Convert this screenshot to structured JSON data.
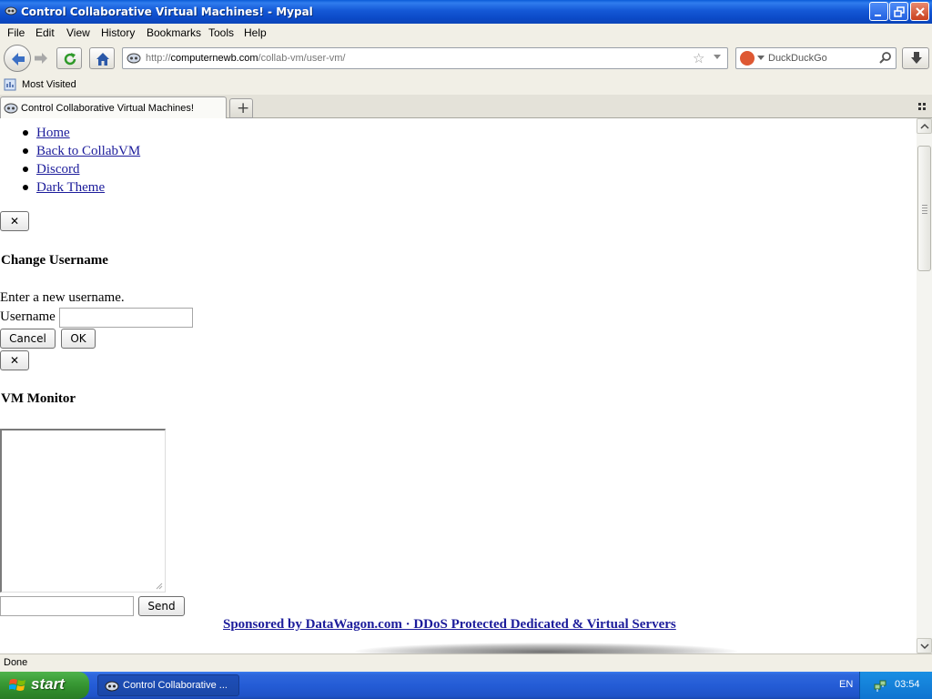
{
  "window": {
    "title": "Control Collaborative Virtual Machines! - Mypal"
  },
  "menu": {
    "items": [
      "File",
      "Edit",
      "View",
      "History",
      "Bookmarks",
      "Tools",
      "Help"
    ]
  },
  "navbar": {
    "url_prefix": "http://",
    "url_domain": "computernewb.com",
    "url_path": "/collab-vm/user-vm/",
    "search_placeholder": "DuckDuckGo"
  },
  "bookmarks": {
    "most_visited": "Most Visited"
  },
  "tabs": [
    {
      "label": "Control Collaborative Virtual Machines!"
    }
  ],
  "page": {
    "nav_links": [
      "Home",
      "Back to CollabVM",
      "Discord",
      "Dark Theme"
    ],
    "close_symbol": "✕",
    "username_dialog": {
      "title": "Change Username",
      "prompt": "Enter a new username.",
      "field_label": "Username",
      "cancel_label": "Cancel",
      "ok_label": "OK"
    },
    "monitor_title": "VM Monitor",
    "send_label": "Send",
    "sponsor_text": "Sponsored by DataWagon.com · DDoS Protected Dedicated & Virtual Servers"
  },
  "statusbar": {
    "text": "Done"
  },
  "taskbar": {
    "start_label": "start",
    "window_item": "Control Collaborative ...",
    "language": "EN",
    "clock": "03:54"
  },
  "colors": {
    "titlebar": "#0b49c6",
    "link": "#1c1c9b",
    "taskbar": "#245cd6",
    "start_button": "#3a9a36"
  }
}
